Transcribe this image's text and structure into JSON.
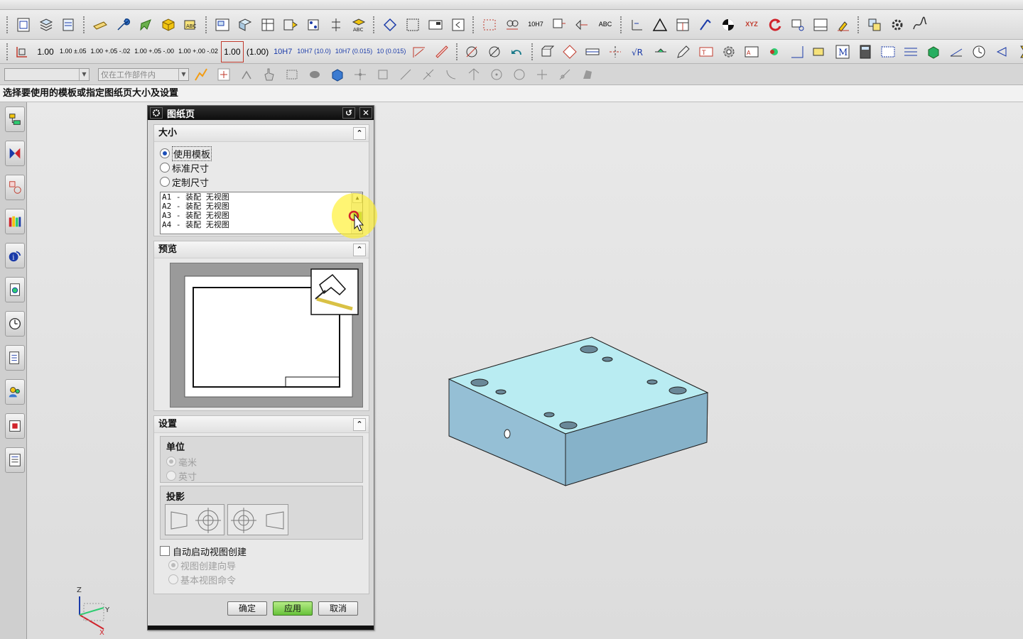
{
  "toolbar": {
    "row1_icons": [
      "new-sheet-icon",
      "layers-icon",
      "sheet-stack-icon",
      "note-icon",
      "wrench-icon",
      "edit-tool-icon",
      "cube-icon",
      "text-format-icon",
      "view-drawing-icon",
      "table-grid-icon",
      "balloon-icon",
      "view-split-icon",
      "dimension-icon",
      "text-abc-icon",
      "align-icon",
      "frame-icon",
      "view-break-icon",
      "section-icon",
      "grid-dots-icon",
      "bolt-icon",
      "annotate-icon",
      "datum-icon",
      "symbol-icon",
      "measure-icon",
      "triangle-icon",
      "table-icon",
      "leader-icon",
      "target-icon",
      "coordinate-icon",
      "refresh-icon",
      "view-icon",
      "window-icon",
      "highlight-icon",
      "shortcut-icon",
      "settings-icon",
      "curve-icon"
    ],
    "row1_labels": {
      "tol_10h7": "10H7",
      "abc": "ABC",
      "xyz": "XYZ"
    },
    "row2_values": [
      "1.00",
      "1.00 ±.05",
      "1.00 +.05 -.02",
      "1.00 +.05 -.00",
      "1.00 +.00 -.02",
      "1.00",
      "(1.00)",
      "10H7",
      "10H7 (10.0)",
      "10H7 (0.015)",
      "10 (0.015)"
    ],
    "row3": {
      "filter_value": "",
      "scope_value": "仅在工作部件内"
    }
  },
  "status_text": "选择要使用的模板或指定图纸页大小及设置",
  "dialog": {
    "title": "图纸页",
    "size_section": {
      "title": "大小",
      "options": [
        "使用模板",
        "标准尺寸",
        "定制尺寸"
      ],
      "selected": "使用模板",
      "templates": [
        "A1 - 装配 无视图",
        "A2 - 装配 无视图",
        "A3 - 装配 无视图",
        "A4 - 装配 无视图"
      ]
    },
    "preview_section": {
      "title": "预览"
    },
    "settings_section": {
      "title": "设置",
      "units_label": "单位",
      "unit_options": [
        "毫米",
        "英寸"
      ],
      "projection_label": "投影",
      "auto_view_label": "自动启动视图创建",
      "auto_view_options": [
        "视图创建向导",
        "基本视图命令"
      ]
    },
    "buttons": {
      "ok": "确定",
      "apply": "应用",
      "cancel": "取消"
    }
  },
  "triad": {
    "x": "X",
    "y": "Y",
    "z": "Z"
  },
  "colors": {
    "part_top": "#b9ecf2",
    "part_side": "#8fb8cf",
    "apply_button": "#7ccf4a",
    "highlight": "#fff028"
  }
}
